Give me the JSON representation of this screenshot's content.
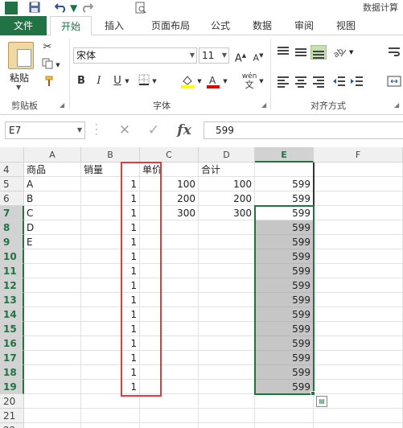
{
  "titlebar": {
    "title": "数据计算",
    "logo_letter": "X"
  },
  "tabs": [
    {
      "label": "文件"
    },
    {
      "label": "开始"
    },
    {
      "label": "插入"
    },
    {
      "label": "页面布局"
    },
    {
      "label": "公式"
    },
    {
      "label": "数据"
    },
    {
      "label": "审阅"
    },
    {
      "label": "视图"
    }
  ],
  "ribbon": {
    "paste_label": "粘贴",
    "clipboard_group": "剪贴板",
    "font_group": "字体",
    "alignment_group": "对齐方式",
    "font_name": "宋体",
    "font_size": "11",
    "bold": "B",
    "italic": "I",
    "underline": "U",
    "wen": "wén",
    "wen_char": "文"
  },
  "formula_bar": {
    "name_box": "E7",
    "formula": "599"
  },
  "columns": [
    "A",
    "B",
    "C",
    "D",
    "E",
    "F"
  ],
  "selected_column": "E",
  "rows": [
    {
      "num": "4",
      "cells": [
        "商品",
        "销量",
        "单价",
        "合计",
        "",
        ""
      ]
    },
    {
      "num": "5",
      "cells": [
        "A",
        "1",
        "100",
        "100",
        "599",
        ""
      ]
    },
    {
      "num": "6",
      "cells": [
        "B",
        "1",
        "200",
        "200",
        "599",
        ""
      ]
    },
    {
      "num": "7",
      "cells": [
        "C",
        "1",
        "300",
        "300",
        "599",
        ""
      ]
    },
    {
      "num": "8",
      "cells": [
        "D",
        "1",
        "",
        "",
        "599",
        ""
      ]
    },
    {
      "num": "9",
      "cells": [
        "E",
        "1",
        "",
        "",
        "599",
        ""
      ]
    },
    {
      "num": "10",
      "cells": [
        "",
        "1",
        "",
        "",
        "599",
        ""
      ]
    },
    {
      "num": "11",
      "cells": [
        "",
        "1",
        "",
        "",
        "599",
        ""
      ]
    },
    {
      "num": "12",
      "cells": [
        "",
        "1",
        "",
        "",
        "599",
        ""
      ]
    },
    {
      "num": "13",
      "cells": [
        "",
        "1",
        "",
        "",
        "599",
        ""
      ]
    },
    {
      "num": "14",
      "cells": [
        "",
        "1",
        "",
        "",
        "599",
        ""
      ]
    },
    {
      "num": "15",
      "cells": [
        "",
        "1",
        "",
        "",
        "599",
        ""
      ]
    },
    {
      "num": "16",
      "cells": [
        "",
        "1",
        "",
        "",
        "599",
        ""
      ]
    },
    {
      "num": "17",
      "cells": [
        "",
        "1",
        "",
        "",
        "599",
        ""
      ]
    },
    {
      "num": "18",
      "cells": [
        "",
        "1",
        "",
        "",
        "599",
        ""
      ]
    },
    {
      "num": "19",
      "cells": [
        "",
        "1",
        "",
        "",
        "599",
        ""
      ]
    },
    {
      "num": "20",
      "cells": [
        "",
        "",
        "",
        "",
        "",
        ""
      ]
    },
    {
      "num": "21",
      "cells": [
        "",
        "",
        "",
        "",
        "",
        ""
      ]
    },
    {
      "num": "22",
      "cells": [
        "",
        "",
        "",
        "",
        "",
        ""
      ]
    }
  ],
  "colors": {
    "accent": "#217346",
    "annotation": "#e03c3c",
    "selection_fill": "#c6c6c6"
  }
}
